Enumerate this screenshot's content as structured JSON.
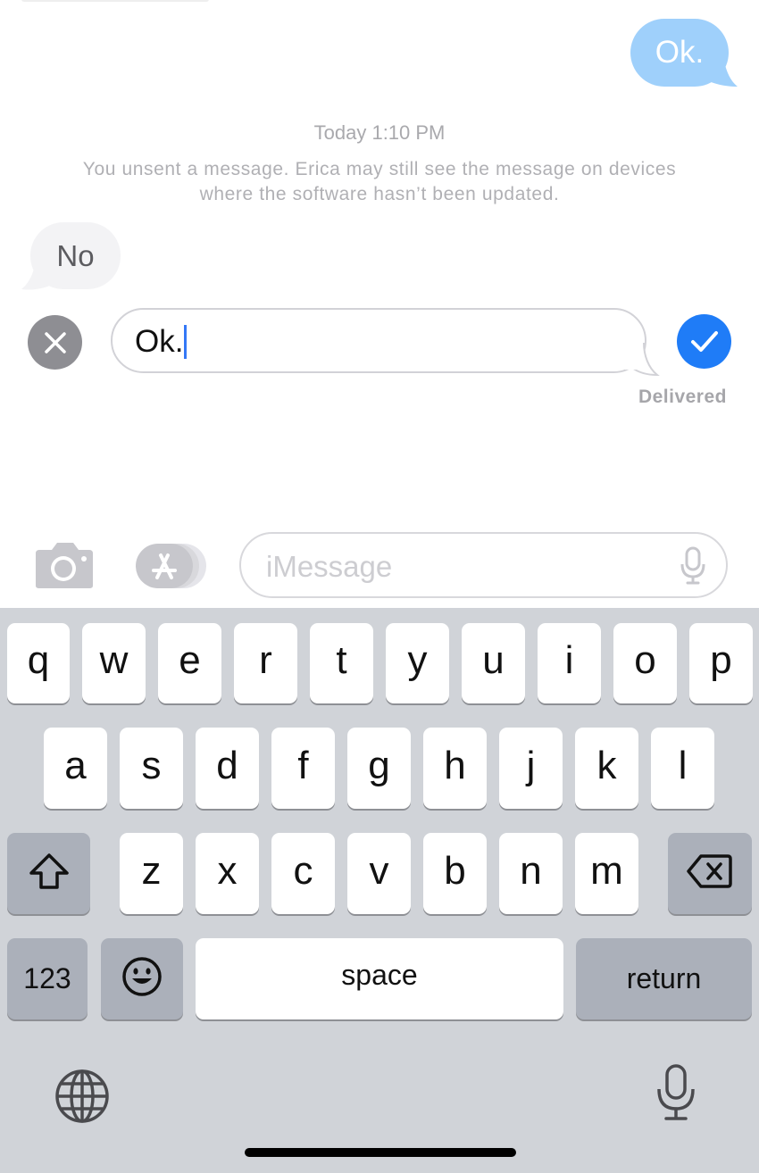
{
  "conversation": {
    "sent_message": "Ok.",
    "timestamp_day": "Today",
    "timestamp_time": "1:10 PM",
    "unsent_notice": "You unsent a message. Erica may still see the message on devices where the software hasn’t been updated.",
    "received_message": "No",
    "edit_text": "Ok.",
    "delivered_status": "Delivered"
  },
  "composer": {
    "placeholder": "iMessage"
  },
  "keyboard": {
    "row1": [
      "q",
      "w",
      "e",
      "r",
      "t",
      "y",
      "u",
      "i",
      "o",
      "p"
    ],
    "row2": [
      "a",
      "s",
      "d",
      "f",
      "g",
      "h",
      "j",
      "k",
      "l"
    ],
    "row3": [
      "z",
      "x",
      "c",
      "v",
      "b",
      "n",
      "m"
    ],
    "numbers_label": "123",
    "space_label": "space",
    "return_label": "return"
  },
  "colors": {
    "sent_bubble": "#9fd0fb",
    "confirm_blue": "#1f7cf7",
    "caret": "#3478f6",
    "keyboard_bg": "#d0d3d8"
  },
  "icons": {
    "cancel": "close-icon",
    "confirm": "checkmark-icon",
    "camera": "camera-icon",
    "apps": "app-store-icon",
    "mic": "microphone-icon",
    "shift": "shift-icon",
    "delete": "backspace-icon",
    "emoji": "emoji-icon",
    "globe": "globe-icon"
  }
}
